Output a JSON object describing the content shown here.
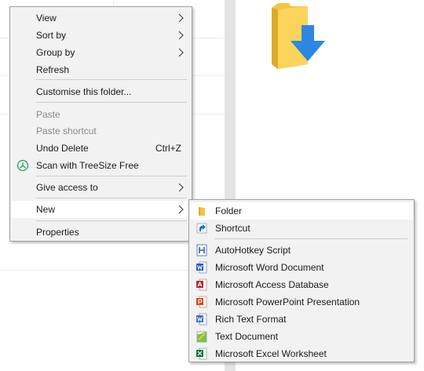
{
  "context_menu": {
    "items": [
      {
        "label": "View",
        "has_submenu": true
      },
      {
        "label": "Sort by",
        "has_submenu": true
      },
      {
        "label": "Group by",
        "has_submenu": true
      },
      {
        "label": "Refresh"
      },
      {
        "label": "Customise this folder..."
      },
      {
        "label": "Paste",
        "disabled": true
      },
      {
        "label": "Paste shortcut",
        "disabled": true
      },
      {
        "label": "Undo Delete",
        "shortcut": "Ctrl+Z"
      },
      {
        "label": "Scan with TreeSize Free",
        "icon": "treesize-icon"
      },
      {
        "label": "Give access to",
        "has_submenu": true
      },
      {
        "label": "New",
        "has_submenu": true,
        "active": true
      },
      {
        "label": "Properties"
      }
    ]
  },
  "new_submenu": {
    "items": [
      {
        "label": "Folder",
        "icon": "folder-icon"
      },
      {
        "label": "Shortcut",
        "icon": "shortcut-icon"
      },
      {
        "label": "AutoHotkey Script",
        "icon": "autohotkey-script-icon"
      },
      {
        "label": "Microsoft Word Document",
        "icon": "word-document-icon"
      },
      {
        "label": "Microsoft Access Database",
        "icon": "access-database-icon"
      },
      {
        "label": "Microsoft PowerPoint Presentation",
        "icon": "powerpoint-icon"
      },
      {
        "label": "Rich Text Format",
        "icon": "rtf-document-icon"
      },
      {
        "label": "Text Document",
        "icon": "text-document-icon"
      },
      {
        "label": "Microsoft Excel Worksheet",
        "icon": "excel-worksheet-icon"
      }
    ]
  },
  "colors": {
    "menu_bg": "#f2f2f2",
    "menu_border": "#a0a0a0",
    "active_item_bg": "#ffffff",
    "disabled_text": "#8a8a8a",
    "folder_yellow": "#f5c542",
    "download_blue": "#2b87e3",
    "treesize_green": "#22a35a"
  }
}
